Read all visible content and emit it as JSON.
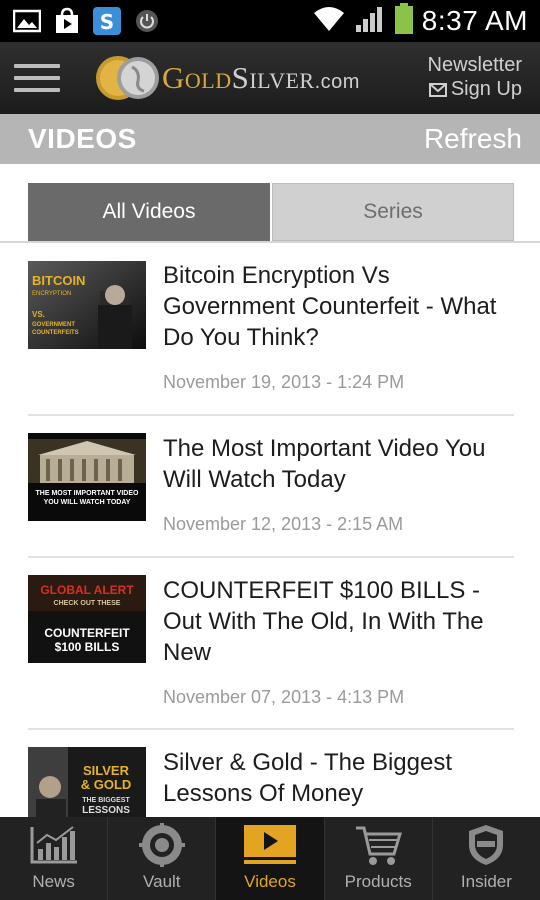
{
  "status_bar": {
    "time": "8:37 AM",
    "icons": [
      "gallery-icon",
      "play-store-icon",
      "shazam-icon",
      "power-icon",
      "wifi-icon",
      "signal-icon",
      "battery-icon"
    ]
  },
  "header": {
    "logo": {
      "brand_gold": "Gold",
      "brand_silver": "Silver",
      "domain": ".com"
    },
    "newsletter_line1": "Newsletter",
    "newsletter_line2": "Sign Up"
  },
  "section": {
    "title": "VIDEOS",
    "refresh_label": "Refresh"
  },
  "tabs": [
    {
      "label": "All Videos",
      "active": true
    },
    {
      "label": "Series",
      "active": false
    }
  ],
  "videos": [
    {
      "title": "Bitcoin Encryption Vs Government Counterfeit - What Do You Think?",
      "date": "November 19, 2013 - 1:24 PM",
      "thumb_text": [
        "BITCOIN",
        "ENCRYPTION",
        "VS.",
        "GOVERNMENT",
        "COUNTERFEITS"
      ]
    },
    {
      "title": "The Most Important Video You Will Watch Today",
      "date": "November 12, 2013 - 2:15 AM",
      "thumb_text": [
        "THE MOST IMPORTANT VIDEO",
        "YOU WILL WATCH TODAY"
      ]
    },
    {
      "title": "COUNTERFEIT $100 BILLS - Out With The Old, In With The New",
      "date": "November 07, 2013 - 4:13 PM",
      "thumb_text": [
        "GLOBAL ALERT",
        "CHECK OUT THESE",
        "COUNTERFEIT",
        "$100 BILLS"
      ]
    },
    {
      "title": "Silver & Gold - The Biggest Lessons Of Money",
      "date": "",
      "thumb_text": [
        "SILVER",
        "& GOLD",
        "THE BIGGEST",
        "LESSONS"
      ]
    }
  ],
  "bottom_nav": [
    {
      "label": "News",
      "icon": "chart-icon",
      "active": false
    },
    {
      "label": "Vault",
      "icon": "vault-icon",
      "active": false
    },
    {
      "label": "Videos",
      "icon": "video-icon",
      "active": true
    },
    {
      "label": "Products",
      "icon": "cart-icon",
      "active": false
    },
    {
      "label": "Insider",
      "icon": "shield-icon",
      "active": false
    }
  ],
  "colors": {
    "accent": "#e3a421",
    "section_bar": "#b5b5b5",
    "active_tab": "#6a6a6a"
  }
}
